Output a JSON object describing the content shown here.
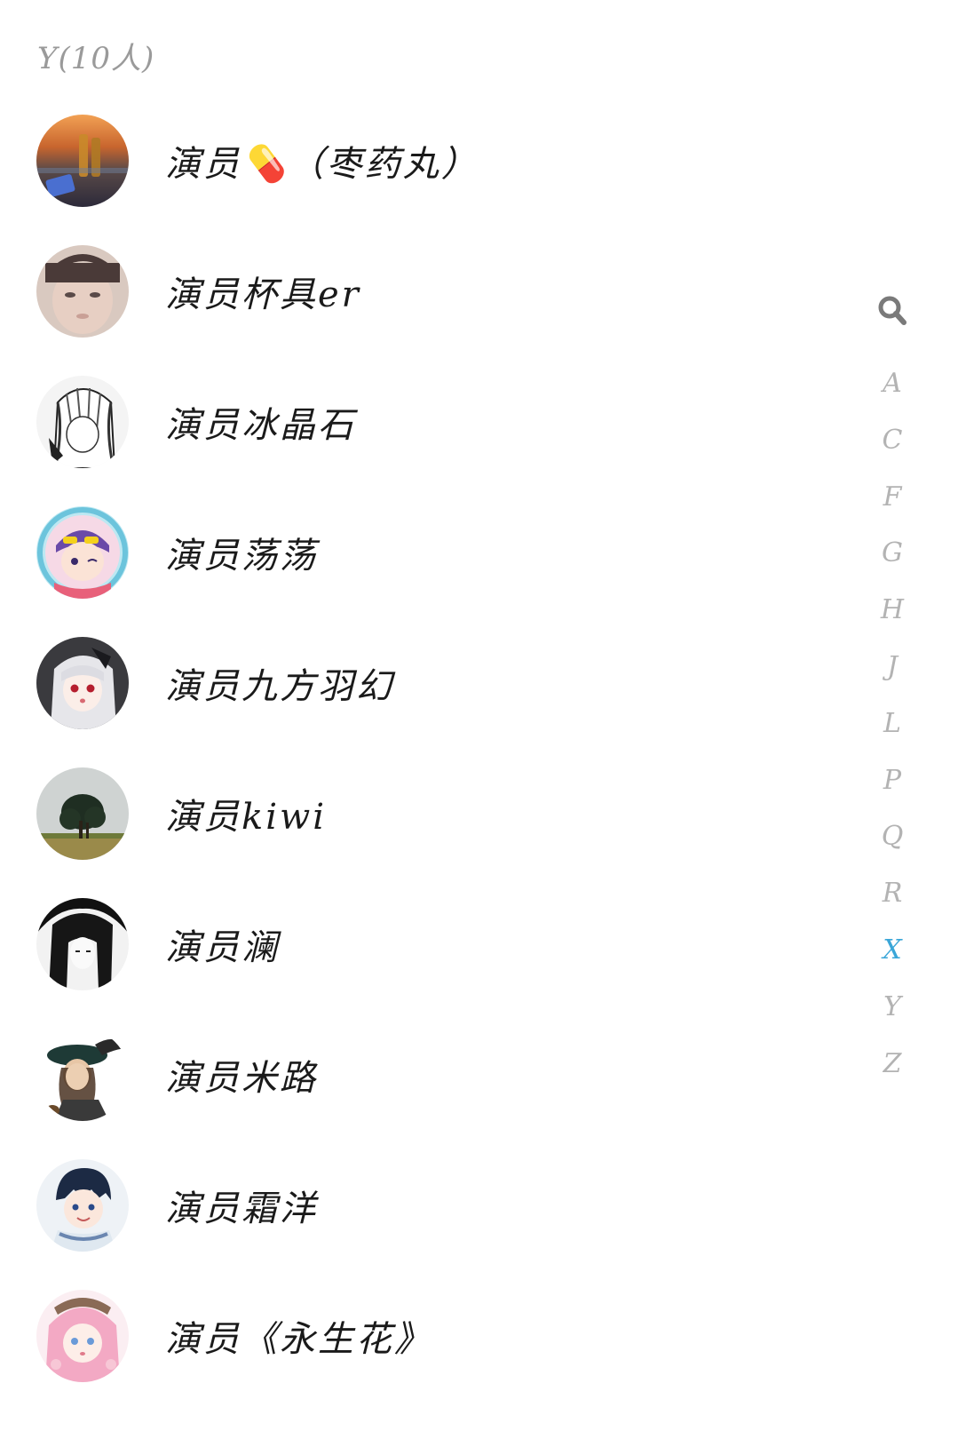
{
  "section": {
    "header": "Y(10人)"
  },
  "contacts": [
    {
      "name": "演员💊（枣药丸）",
      "avatar": "sunset-beer-avatar"
    },
    {
      "name": "演员杯具er",
      "avatar": "child-face-avatar"
    },
    {
      "name": "演员冰晶石",
      "avatar": "manga-girl-avatar"
    },
    {
      "name": "演员荡荡",
      "avatar": "chibi-sunglasses-avatar"
    },
    {
      "name": "演员九方羽幻",
      "avatar": "white-hair-girl-avatar"
    },
    {
      "name": "演员kiwi",
      "avatar": "tree-landscape-avatar"
    },
    {
      "name": "演员澜",
      "avatar": "dark-hair-sketch-avatar"
    },
    {
      "name": "演员米路",
      "avatar": "feather-hat-portrait-avatar"
    },
    {
      "name": "演员霜洋",
      "avatar": "anime-boy-avatar"
    },
    {
      "name": "演员《永生花》",
      "avatar": "pink-hair-girl-avatar"
    }
  ],
  "index_bar": {
    "search_icon": "search-icon",
    "letters": [
      "A",
      "C",
      "F",
      "G",
      "H",
      "J",
      "L",
      "P",
      "Q",
      "R",
      "X",
      "Y",
      "Z"
    ],
    "active_letter": "X",
    "active_color": "#3aa6d8"
  }
}
